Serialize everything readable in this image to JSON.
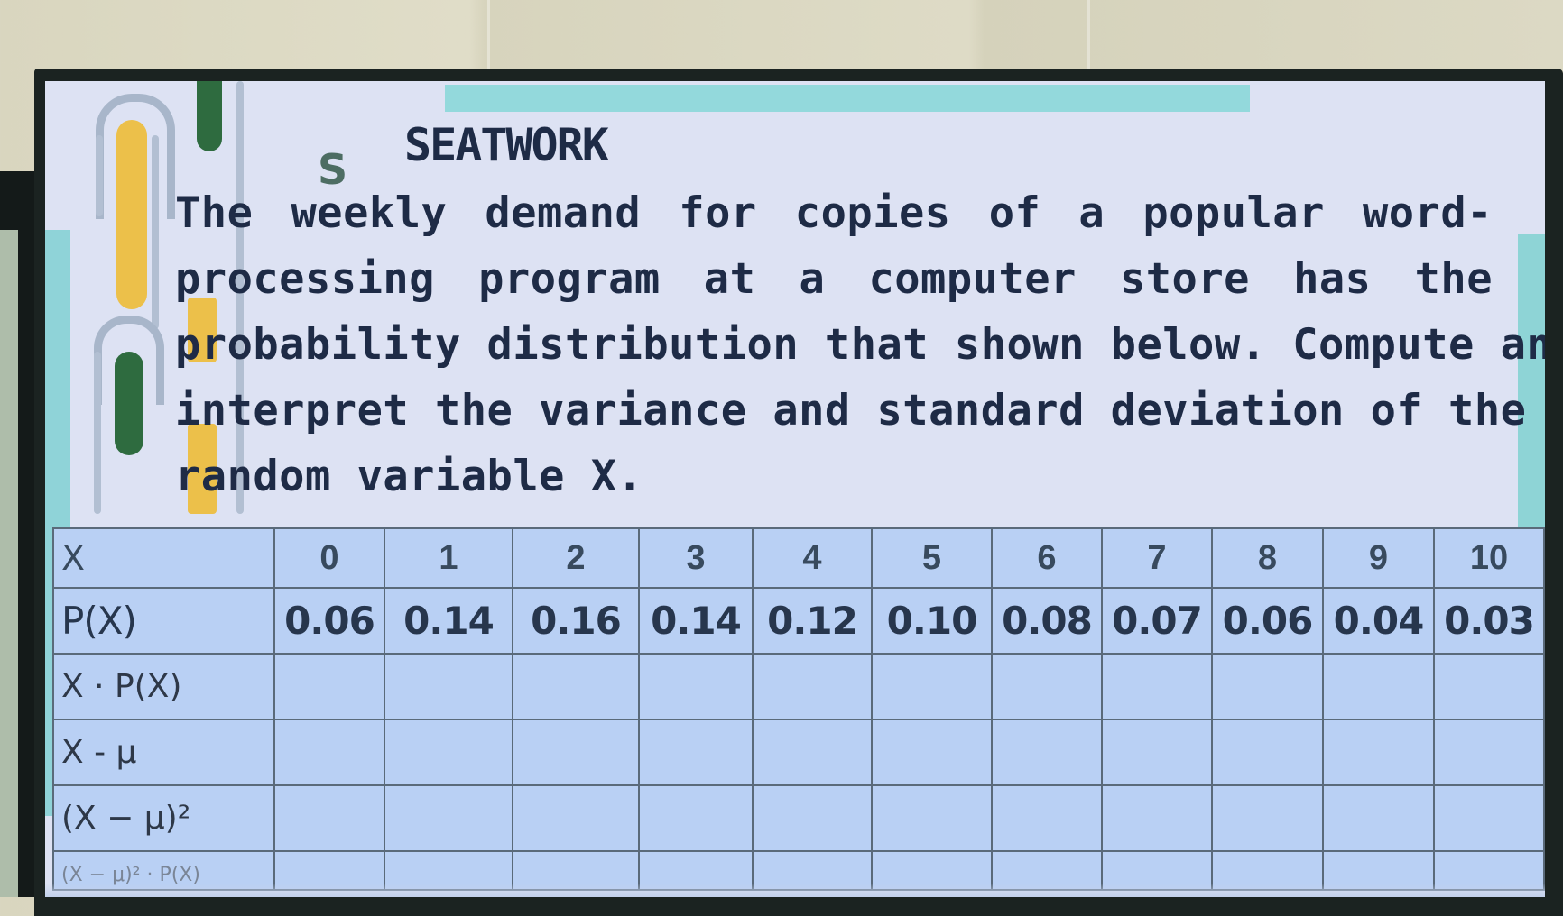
{
  "slide": {
    "title": "SEATWORK",
    "title_icon": "S",
    "problem_lines": [
      "The weekly demand for copies of a popular word-",
      "processing program at a computer store has the",
      "probability distribution that shown below. Compute and",
      "interpret the variance and standard deviation of the",
      "random variable X."
    ]
  },
  "table": {
    "rows": [
      {
        "label": "X",
        "cells": [
          "0",
          "1",
          "2",
          "3",
          "4",
          "5",
          "6",
          "7",
          "8",
          "9",
          "10"
        ]
      },
      {
        "label": "P(X)",
        "cells": [
          "0.06",
          "0.14",
          "0.16",
          "0.14",
          "0.12",
          "0.10",
          "0.08",
          "0.07",
          "0.06",
          "0.04",
          "0.03"
        ]
      },
      {
        "label": "X · P(X)",
        "cells": [
          "",
          "",
          "",
          "",
          "",
          "",
          "",
          "",
          "",
          "",
          ""
        ]
      },
      {
        "label": "X - μ",
        "cells": [
          "",
          "",
          "",
          "",
          "",
          "",
          "",
          "",
          "",
          "",
          ""
        ]
      },
      {
        "label": "(X − μ)²",
        "cells": [
          "",
          "",
          "",
          "",
          "",
          "",
          "",
          "",
          "",
          "",
          ""
        ]
      }
    ],
    "partial_row_label": "(X − μ)² · P(X)"
  },
  "colors": {
    "slide_bg": "#dde2f3",
    "table_bg": "#b9d0f4",
    "accent_teal": "#93d9dc",
    "accent_yellow": "#ecc04a",
    "accent_green": "#2e6b3f",
    "text_dark": "#1e2b46"
  }
}
